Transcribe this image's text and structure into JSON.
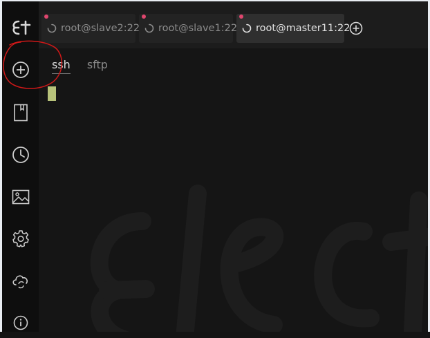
{
  "sidebar": {
    "logo": "E†",
    "items": [
      {
        "icon": "plus-circle-icon"
      },
      {
        "icon": "bookmark-icon"
      },
      {
        "icon": "clock-icon"
      },
      {
        "icon": "image-icon"
      },
      {
        "icon": "gear-icon"
      },
      {
        "icon": "cloud-sync-icon"
      },
      {
        "icon": "info-icon"
      }
    ]
  },
  "tabs": [
    {
      "label": "root@slave2:22",
      "active": false
    },
    {
      "label": "root@slave1:22",
      "active": false
    },
    {
      "label": "root@master11:22",
      "active": true
    }
  ],
  "subtabs": [
    {
      "label": "ssh",
      "active": true
    },
    {
      "label": "sftp",
      "active": false
    }
  ],
  "colors": {
    "accent_dot": "#e0466e",
    "terminal_cursor": "#b7c27a",
    "annotation": "#d01818"
  }
}
